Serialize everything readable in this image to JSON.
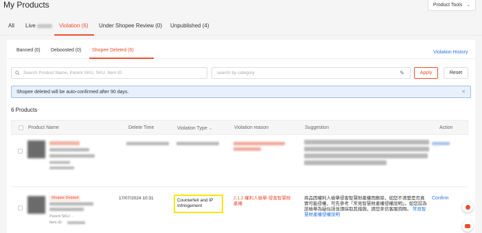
{
  "header": {
    "title": "My Products",
    "tools_label": "Product Tools"
  },
  "main_tabs": [
    {
      "label": "All"
    },
    {
      "label": "Live"
    },
    {
      "label": "Violation (6)"
    },
    {
      "label": "Under Shopee Review (0)"
    },
    {
      "label": "Unpublished (4)"
    }
  ],
  "sub_tabs": [
    {
      "label": "Banned (0)"
    },
    {
      "label": "Deboosted (0)"
    },
    {
      "label": "Shopee Deleted (6)"
    }
  ],
  "violation_history_label": "Violation History",
  "search": {
    "placeholder": "Search Product Name, Parent SKU, SKU, Item ID",
    "category_placeholder": "search by category",
    "apply_label": "Apply",
    "reset_label": "Reset"
  },
  "notice": "Shopee deleted will be auto-confirmed after 90 days.",
  "count_label": "6 Products",
  "table": {
    "columns": [
      "Product Name",
      "Delete Time",
      "Violation Type",
      "Violation reason",
      "Suggestion",
      "Action"
    ],
    "rows": [
      {
        "badge": "Shopee Deleted",
        "parent_sku": "Parent SKU: -",
        "item_id": "Item ID:",
        "delete_time": "17/07/2024 10:31",
        "violation_type": "Counterfeit and IP Infringement",
        "violation_reason": "2.1.2 權利人檢舉-侵害智慧財產權",
        "suggestion": "商品因權利人檢舉侵害智慧財產權而刪除，如您不清楚是否真實可能侵權，可先參考「常見智慧財產權侵權說明」，如您認為該檢舉為疑似誤並請採取其措施，請您來信客服詢問。",
        "suggestion_link": "常見智慧財產權侵權說明",
        "action": "Confirm"
      }
    ]
  },
  "icons": {
    "tools_chevron": "chevron-down-icon",
    "search": "search-icon",
    "pencil": "pencil-icon",
    "close": "close-icon"
  },
  "colors": {
    "accent": "#ee4d2d",
    "link": "#2673dd",
    "highlight": "#ffe500"
  }
}
